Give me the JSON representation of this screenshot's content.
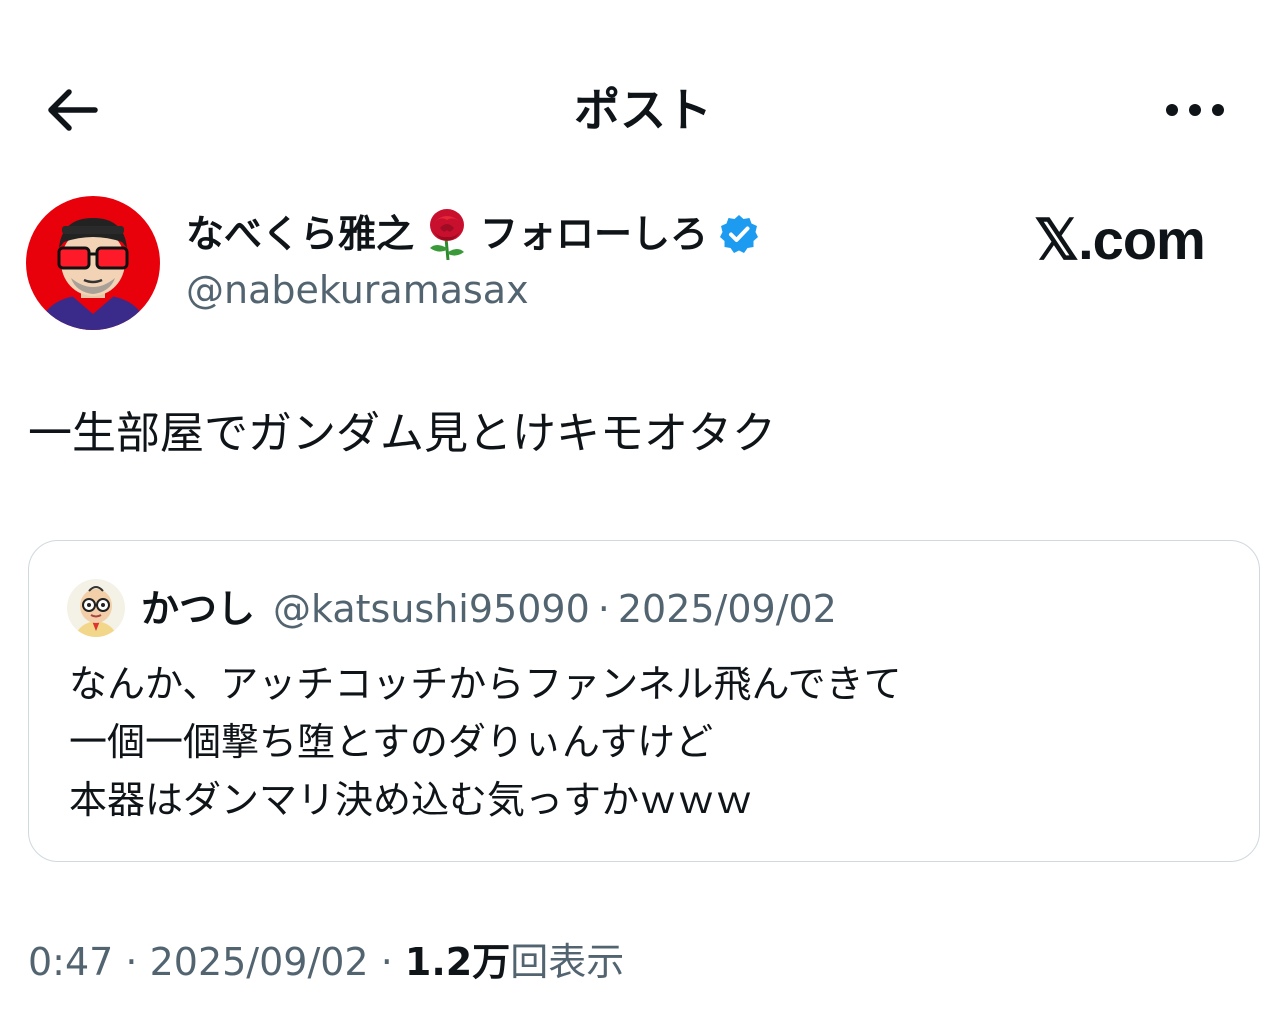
{
  "header": {
    "title": "ポスト",
    "back_icon": "arrow-left-icon",
    "more_icon": "more-horizontal-icon"
  },
  "author": {
    "name": "なべくら雅之",
    "emoji": "rose",
    "name_suffix": "フォローしろ",
    "verified": true,
    "handle": "@nabekuramasax"
  },
  "watermark": "𝕏.com",
  "post": {
    "text": "一生部屋でガンダム見とけキモオタク"
  },
  "quote": {
    "name": "かつし",
    "handle": "@katsushi95090",
    "separator": "·",
    "date": "2025/09/02",
    "lines": [
      "なんか、アッチコッチからファンネル飛んできて",
      "一個一個撃ち堕とすのダりぃんすけど",
      "本器はダンマリ決め込む気っすかｗｗｗ"
    ]
  },
  "meta": {
    "time": "0:47",
    "separator": " · ",
    "date": "2025/09/02",
    "views_count": "1.2万",
    "views_label": "回表示"
  },
  "colors": {
    "text": "#0f1419",
    "secondary": "#536471",
    "verified": "#1d9bf0",
    "border": "#cfd9de",
    "avatar_bg": "#e8000b"
  }
}
